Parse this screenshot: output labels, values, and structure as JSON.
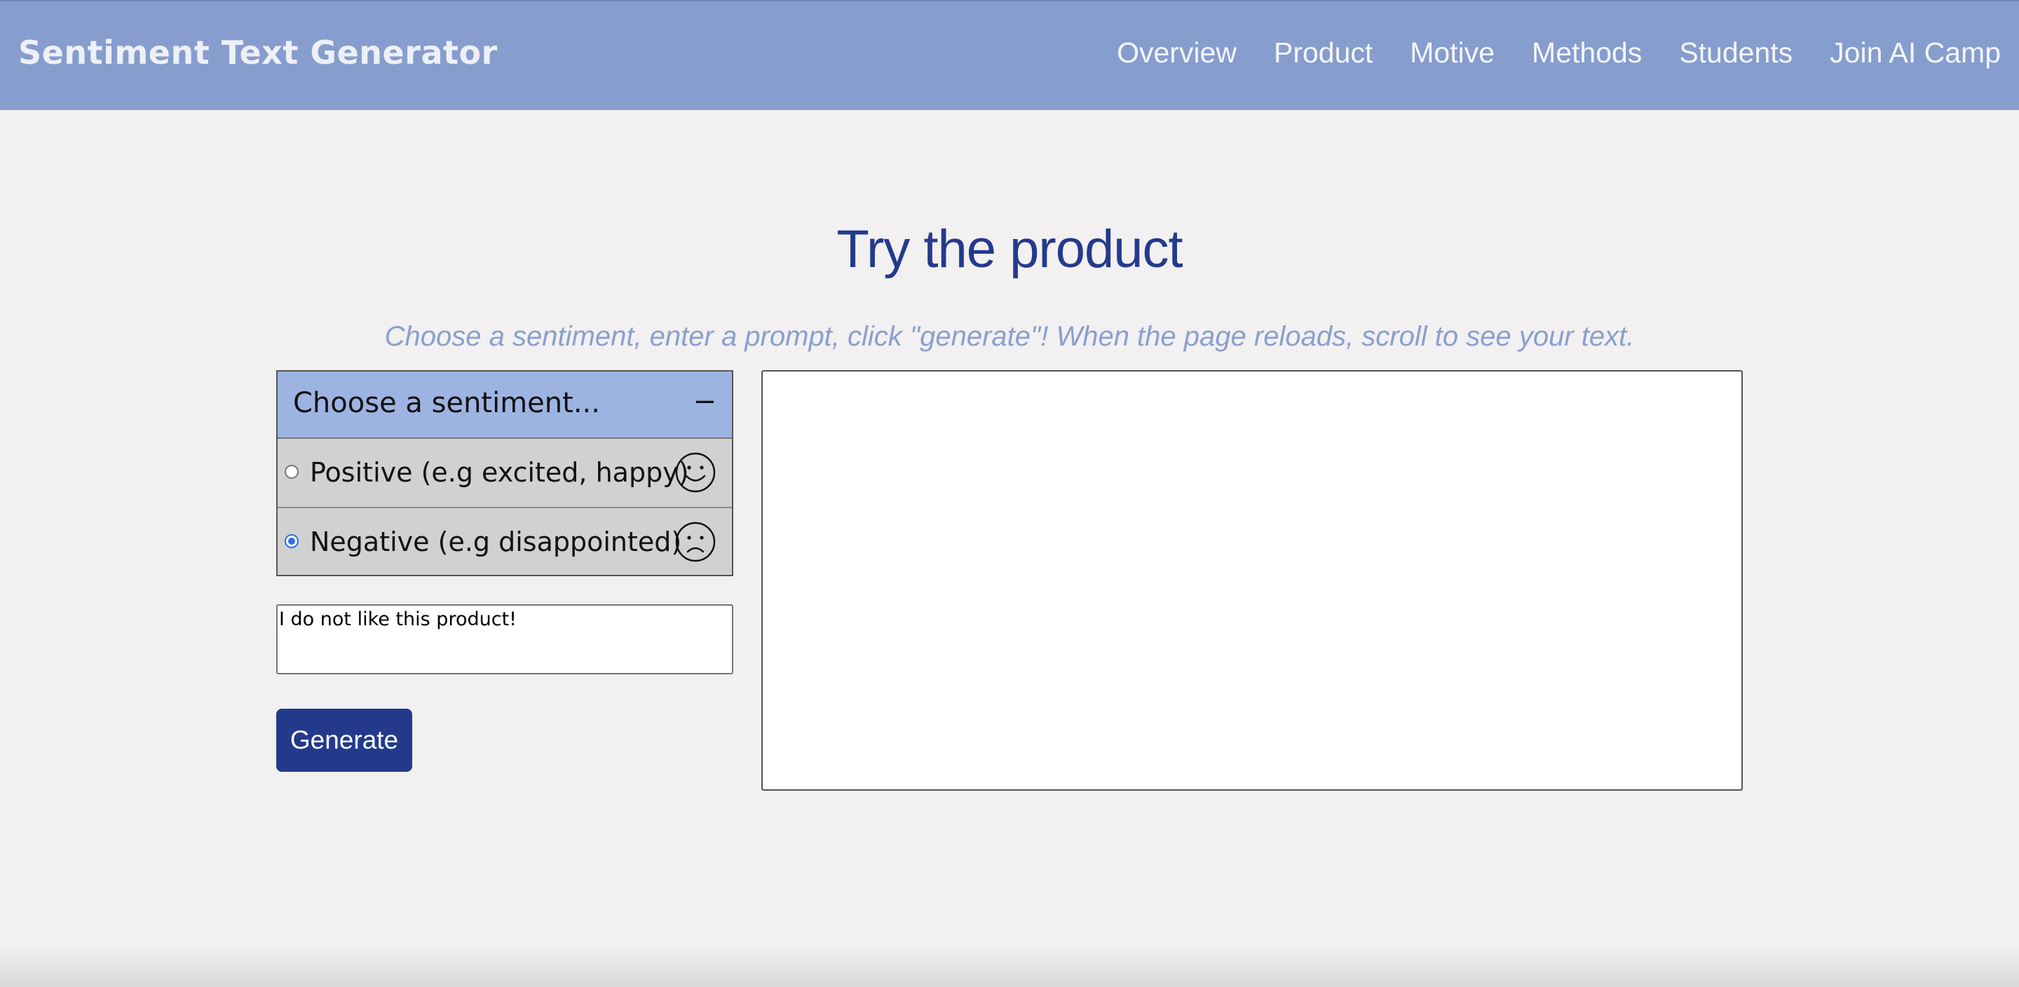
{
  "header": {
    "brand": "Sentiment Text Generator",
    "nav": [
      "Overview",
      "Product",
      "Motive",
      "Methods",
      "Students",
      "Join AI Camp"
    ],
    "background_color": "#869dcd"
  },
  "main": {
    "title": "Try the product",
    "subtitle": "Choose a sentiment, enter a prompt, click \"generate\"! When the page reloads, scroll to see your text."
  },
  "sentiment_panel": {
    "heading": "Choose a sentiment...",
    "toggle_symbol": "−",
    "options": [
      {
        "label": "Positive (e.g excited, happy)",
        "checked": false,
        "icon": "smiley-face-icon"
      },
      {
        "label": "Negative (e.g disappointed)",
        "checked": true,
        "icon": "frowning-face-icon"
      }
    ]
  },
  "prompt": {
    "value": "I do not like this product!"
  },
  "generate_button": {
    "label": "Generate",
    "color": "#233a8c"
  },
  "output": {
    "value": ""
  }
}
